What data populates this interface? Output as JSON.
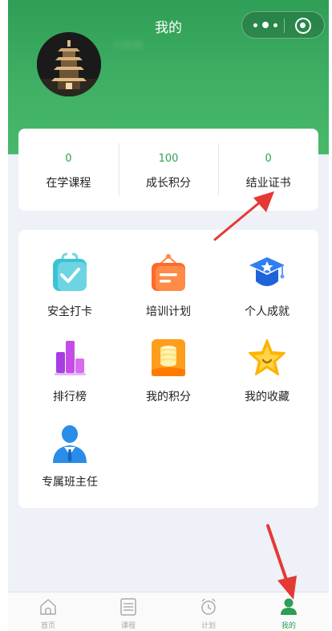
{
  "header": {
    "title": "我的",
    "username": "' '' ''"
  },
  "stats": [
    {
      "value": "0",
      "label": "在学课程"
    },
    {
      "value": "100",
      "label": "成长积分"
    },
    {
      "value": "0",
      "label": "结业证书"
    }
  ],
  "menu": [
    {
      "label": "安全打卡",
      "icon": "check-bag-icon"
    },
    {
      "label": "培训计划",
      "icon": "plan-board-icon"
    },
    {
      "label": "个人成就",
      "icon": "graduation-cap-icon"
    },
    {
      "label": "排行榜",
      "icon": "bar-chart-icon"
    },
    {
      "label": "我的积分",
      "icon": "coins-icon"
    },
    {
      "label": "我的收藏",
      "icon": "star-icon"
    },
    {
      "label": "专属班主任",
      "icon": "teacher-icon"
    }
  ],
  "tabbar": [
    {
      "label": "首页",
      "icon": "home-icon"
    },
    {
      "label": "课程",
      "icon": "list-icon"
    },
    {
      "label": "计划",
      "icon": "alarm-clock-icon"
    },
    {
      "label": "我的",
      "icon": "person-icon",
      "active": true
    }
  ],
  "colors": {
    "brand": "#3fb064",
    "accent_text": "#2e9e55",
    "arrow": "#e53935",
    "page_bg": "#eef1f8"
  }
}
